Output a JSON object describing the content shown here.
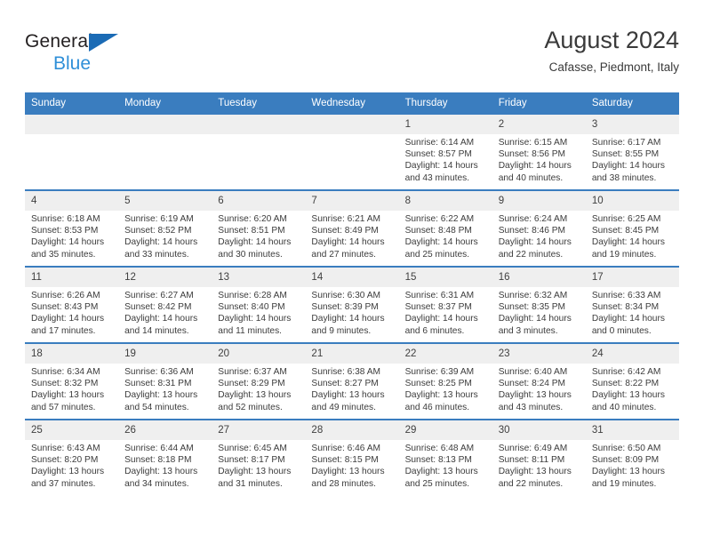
{
  "brand": {
    "name_part1": "General",
    "name_part2": "Blue",
    "triangle_color": "#1b6bb5",
    "blue_color": "#2f8fd8"
  },
  "header": {
    "title": "August 2024",
    "location": "Cafasse, Piedmont, Italy"
  },
  "theme": {
    "header_bg": "#3a7dbf",
    "daynum_bg": "#efefef",
    "row_divider": "#3a7dbf",
    "text": "#3c3c3c"
  },
  "weekday_headers": [
    "Sunday",
    "Monday",
    "Tuesday",
    "Wednesday",
    "Thursday",
    "Friday",
    "Saturday"
  ],
  "weeks": [
    [
      {
        "day": "",
        "empty": true
      },
      {
        "day": "",
        "empty": true
      },
      {
        "day": "",
        "empty": true
      },
      {
        "day": "",
        "empty": true
      },
      {
        "day": "1",
        "sunrise": "Sunrise: 6:14 AM",
        "sunset": "Sunset: 8:57 PM",
        "daylight": "Daylight: 14 hours and 43 minutes."
      },
      {
        "day": "2",
        "sunrise": "Sunrise: 6:15 AM",
        "sunset": "Sunset: 8:56 PM",
        "daylight": "Daylight: 14 hours and 40 minutes."
      },
      {
        "day": "3",
        "sunrise": "Sunrise: 6:17 AM",
        "sunset": "Sunset: 8:55 PM",
        "daylight": "Daylight: 14 hours and 38 minutes."
      }
    ],
    [
      {
        "day": "4",
        "sunrise": "Sunrise: 6:18 AM",
        "sunset": "Sunset: 8:53 PM",
        "daylight": "Daylight: 14 hours and 35 minutes."
      },
      {
        "day": "5",
        "sunrise": "Sunrise: 6:19 AM",
        "sunset": "Sunset: 8:52 PM",
        "daylight": "Daylight: 14 hours and 33 minutes."
      },
      {
        "day": "6",
        "sunrise": "Sunrise: 6:20 AM",
        "sunset": "Sunset: 8:51 PM",
        "daylight": "Daylight: 14 hours and 30 minutes."
      },
      {
        "day": "7",
        "sunrise": "Sunrise: 6:21 AM",
        "sunset": "Sunset: 8:49 PM",
        "daylight": "Daylight: 14 hours and 27 minutes."
      },
      {
        "day": "8",
        "sunrise": "Sunrise: 6:22 AM",
        "sunset": "Sunset: 8:48 PM",
        "daylight": "Daylight: 14 hours and 25 minutes."
      },
      {
        "day": "9",
        "sunrise": "Sunrise: 6:24 AM",
        "sunset": "Sunset: 8:46 PM",
        "daylight": "Daylight: 14 hours and 22 minutes."
      },
      {
        "day": "10",
        "sunrise": "Sunrise: 6:25 AM",
        "sunset": "Sunset: 8:45 PM",
        "daylight": "Daylight: 14 hours and 19 minutes."
      }
    ],
    [
      {
        "day": "11",
        "sunrise": "Sunrise: 6:26 AM",
        "sunset": "Sunset: 8:43 PM",
        "daylight": "Daylight: 14 hours and 17 minutes."
      },
      {
        "day": "12",
        "sunrise": "Sunrise: 6:27 AM",
        "sunset": "Sunset: 8:42 PM",
        "daylight": "Daylight: 14 hours and 14 minutes."
      },
      {
        "day": "13",
        "sunrise": "Sunrise: 6:28 AM",
        "sunset": "Sunset: 8:40 PM",
        "daylight": "Daylight: 14 hours and 11 minutes."
      },
      {
        "day": "14",
        "sunrise": "Sunrise: 6:30 AM",
        "sunset": "Sunset: 8:39 PM",
        "daylight": "Daylight: 14 hours and 9 minutes."
      },
      {
        "day": "15",
        "sunrise": "Sunrise: 6:31 AM",
        "sunset": "Sunset: 8:37 PM",
        "daylight": "Daylight: 14 hours and 6 minutes."
      },
      {
        "day": "16",
        "sunrise": "Sunrise: 6:32 AM",
        "sunset": "Sunset: 8:35 PM",
        "daylight": "Daylight: 14 hours and 3 minutes."
      },
      {
        "day": "17",
        "sunrise": "Sunrise: 6:33 AM",
        "sunset": "Sunset: 8:34 PM",
        "daylight": "Daylight: 14 hours and 0 minutes."
      }
    ],
    [
      {
        "day": "18",
        "sunrise": "Sunrise: 6:34 AM",
        "sunset": "Sunset: 8:32 PM",
        "daylight": "Daylight: 13 hours and 57 minutes."
      },
      {
        "day": "19",
        "sunrise": "Sunrise: 6:36 AM",
        "sunset": "Sunset: 8:31 PM",
        "daylight": "Daylight: 13 hours and 54 minutes."
      },
      {
        "day": "20",
        "sunrise": "Sunrise: 6:37 AM",
        "sunset": "Sunset: 8:29 PM",
        "daylight": "Daylight: 13 hours and 52 minutes."
      },
      {
        "day": "21",
        "sunrise": "Sunrise: 6:38 AM",
        "sunset": "Sunset: 8:27 PM",
        "daylight": "Daylight: 13 hours and 49 minutes."
      },
      {
        "day": "22",
        "sunrise": "Sunrise: 6:39 AM",
        "sunset": "Sunset: 8:25 PM",
        "daylight": "Daylight: 13 hours and 46 minutes."
      },
      {
        "day": "23",
        "sunrise": "Sunrise: 6:40 AM",
        "sunset": "Sunset: 8:24 PM",
        "daylight": "Daylight: 13 hours and 43 minutes."
      },
      {
        "day": "24",
        "sunrise": "Sunrise: 6:42 AM",
        "sunset": "Sunset: 8:22 PM",
        "daylight": "Daylight: 13 hours and 40 minutes."
      }
    ],
    [
      {
        "day": "25",
        "sunrise": "Sunrise: 6:43 AM",
        "sunset": "Sunset: 8:20 PM",
        "daylight": "Daylight: 13 hours and 37 minutes."
      },
      {
        "day": "26",
        "sunrise": "Sunrise: 6:44 AM",
        "sunset": "Sunset: 8:18 PM",
        "daylight": "Daylight: 13 hours and 34 minutes."
      },
      {
        "day": "27",
        "sunrise": "Sunrise: 6:45 AM",
        "sunset": "Sunset: 8:17 PM",
        "daylight": "Daylight: 13 hours and 31 minutes."
      },
      {
        "day": "28",
        "sunrise": "Sunrise: 6:46 AM",
        "sunset": "Sunset: 8:15 PM",
        "daylight": "Daylight: 13 hours and 28 minutes."
      },
      {
        "day": "29",
        "sunrise": "Sunrise: 6:48 AM",
        "sunset": "Sunset: 8:13 PM",
        "daylight": "Daylight: 13 hours and 25 minutes."
      },
      {
        "day": "30",
        "sunrise": "Sunrise: 6:49 AM",
        "sunset": "Sunset: 8:11 PM",
        "daylight": "Daylight: 13 hours and 22 minutes."
      },
      {
        "day": "31",
        "sunrise": "Sunrise: 6:50 AM",
        "sunset": "Sunset: 8:09 PM",
        "daylight": "Daylight: 13 hours and 19 minutes."
      }
    ]
  ]
}
